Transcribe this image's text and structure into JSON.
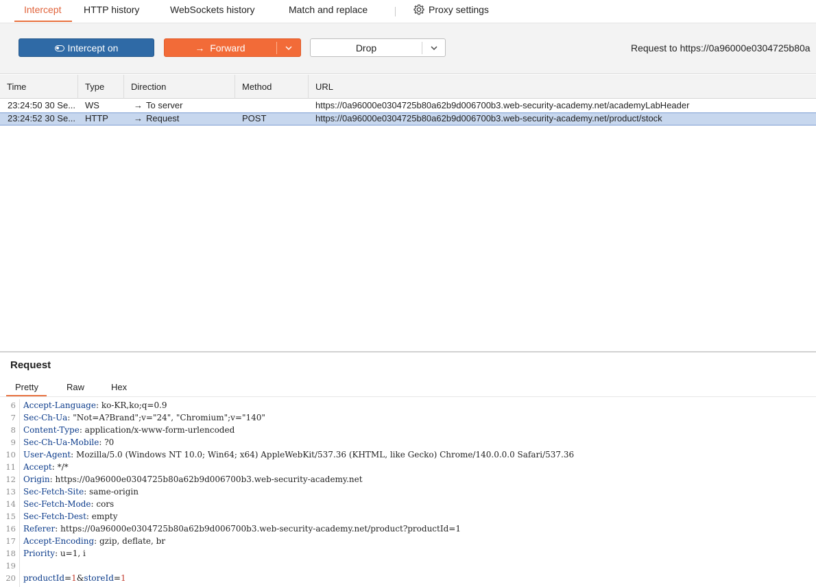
{
  "tabs": {
    "intercept": "Intercept",
    "http_history": "HTTP history",
    "websockets_history": "WebSockets history",
    "match_replace": "Match and replace",
    "proxy_settings": "Proxy settings"
  },
  "toolbar": {
    "intercept_label": "Intercept on",
    "forward_label": "Forward",
    "drop_label": "Drop",
    "request_to": "Request to https://0a96000e0304725b80a"
  },
  "table": {
    "headers": {
      "time": "Time",
      "type": "Type",
      "direction": "Direction",
      "method": "Method",
      "url": "URL"
    },
    "rows": [
      {
        "time": "23:24:50 30 Se...",
        "type": "WS",
        "direction": "To server",
        "method": "",
        "url": "https://0a96000e0304725b80a62b9d006700b3.web-security-academy.net/academyLabHeader"
      },
      {
        "time": "23:24:52 30 Se...",
        "type": "HTTP",
        "direction": "Request",
        "method": "POST",
        "url": "https://0a96000e0304725b80a62b9d006700b3.web-security-academy.net/product/stock"
      }
    ]
  },
  "request_panel": {
    "title": "Request",
    "subtabs": {
      "pretty": "Pretty",
      "raw": "Raw",
      "hex": "Hex"
    },
    "lines": [
      {
        "n": "6",
        "k": "Accept-Language",
        "v": " ko-KR,ko;q=0.9"
      },
      {
        "n": "7",
        "k": "Sec-Ch-Ua",
        "v": " \"Not=A?Brand\";v=\"24\", \"Chromium\";v=\"140\""
      },
      {
        "n": "8",
        "k": "Content-Type",
        "v": " application/x-www-form-urlencoded"
      },
      {
        "n": "9",
        "k": "Sec-Ch-Ua-Mobile",
        "v": " ?0"
      },
      {
        "n": "10",
        "k": "User-Agent",
        "v": " Mozilla/5.0 (Windows NT 10.0; Win64; x64) AppleWebKit/537.36 (KHTML, like Gecko) Chrome/140.0.0.0 Safari/537.36"
      },
      {
        "n": "11",
        "k": "Accept",
        "v": " */*"
      },
      {
        "n": "12",
        "k": "Origin",
        "v": " https://0a96000e0304725b80a62b9d006700b3.web-security-academy.net"
      },
      {
        "n": "13",
        "k": "Sec-Fetch-Site",
        "v": " same-origin"
      },
      {
        "n": "14",
        "k": "Sec-Fetch-Mode",
        "v": " cors"
      },
      {
        "n": "15",
        "k": "Sec-Fetch-Dest",
        "v": " empty"
      },
      {
        "n": "16",
        "k": "Referer",
        "v": " https://0a96000e0304725b80a62b9d006700b3.web-security-academy.net/product?productId=1"
      },
      {
        "n": "17",
        "k": "Accept-Encoding",
        "v": " gzip, deflate, br"
      },
      {
        "n": "18",
        "k": "Priority",
        "v": " u=1, i"
      },
      {
        "n": "19",
        "k": "",
        "v": ""
      }
    ],
    "body_line": {
      "n": "20",
      "k1": "productId",
      "v1": "1",
      "amp": "&",
      "k2": "storeId",
      "v2": "1",
      "eq": "="
    }
  }
}
